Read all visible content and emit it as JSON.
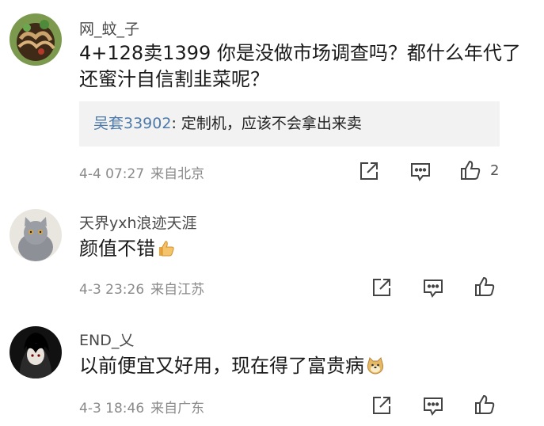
{
  "comments": [
    {
      "username": "网_蚊_子",
      "content": "4+128卖1399 你是没做市场调查吗？都什么年代了 还蜜汁自信割韭菜呢？",
      "reply": {
        "user": "吴套33902",
        "text": ": 定制机，应该不会拿出来卖"
      },
      "time": "4-4 07:27",
      "location": "来自北京",
      "likes": "2"
    },
    {
      "username": "天界yxh浪迹天涯",
      "content": "颜值不错",
      "content_emoji": "thumbs-up-emoji",
      "time": "4-3 23:26",
      "location": "来自江苏",
      "likes": ""
    },
    {
      "username": "END_乂",
      "content": "以前便宜又好用，现在得了富贵病",
      "content_emoji": "doge-emoji",
      "time": "4-3 18:46",
      "location": "来自广东",
      "likes": ""
    }
  ],
  "icons": {
    "share": "share-icon",
    "comment": "comment-icon",
    "like": "like-icon"
  },
  "colors": {
    "reply_user": "#4d7aa8",
    "meta": "#8a8a8a",
    "reply_bg": "#f2f2f2"
  }
}
